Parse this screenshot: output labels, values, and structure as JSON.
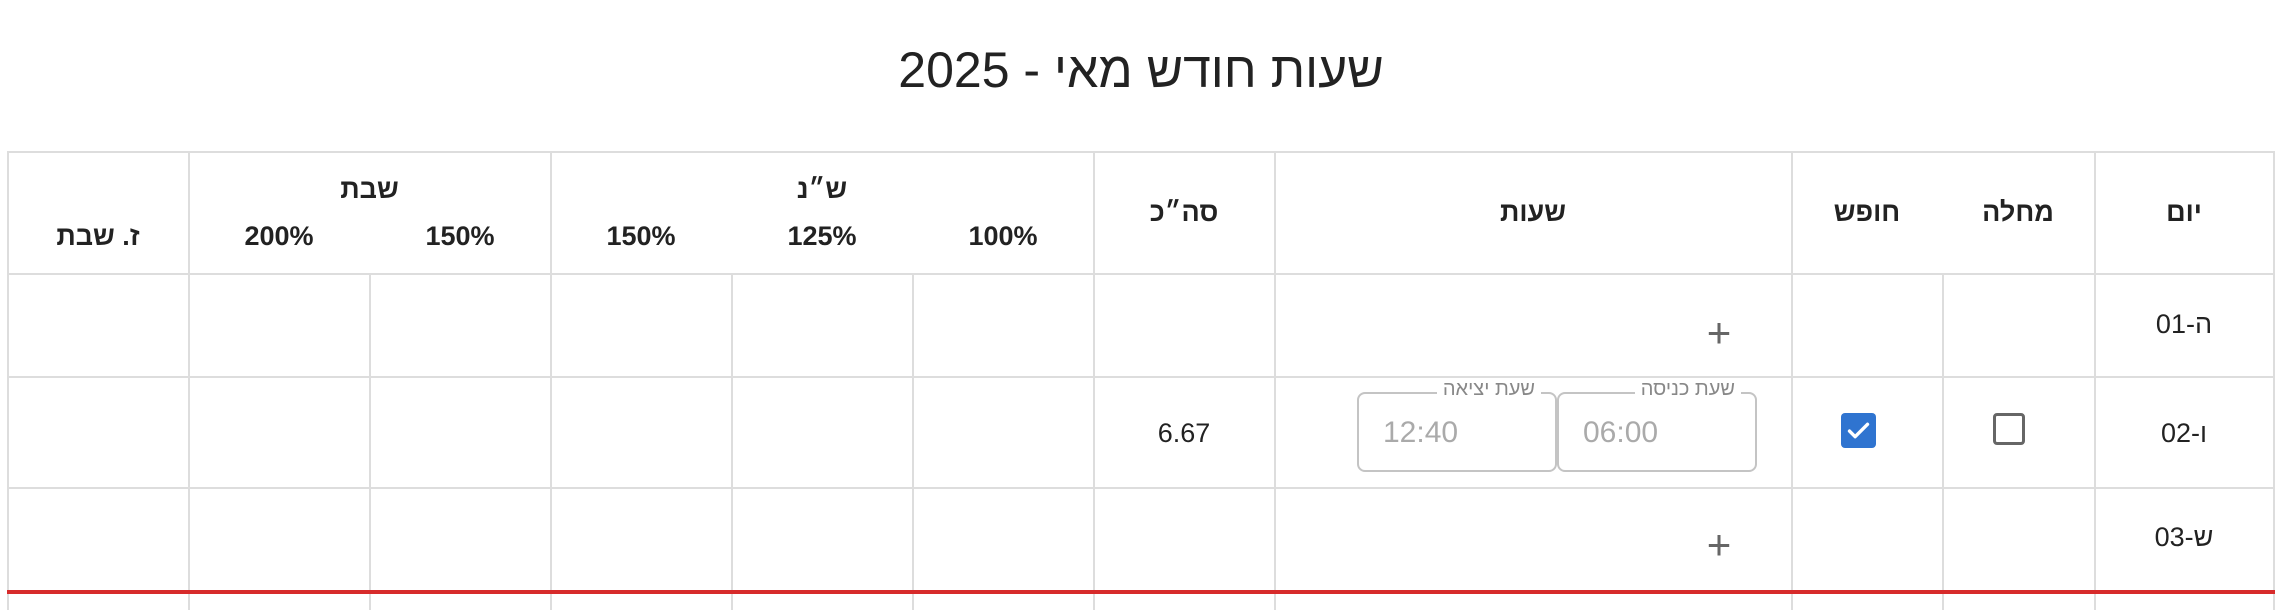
{
  "title": "שעות חודש מאי - 2025",
  "headers": {
    "day": "יום",
    "sick": "מחלה",
    "vacation": "חופש",
    "hours": "שעות",
    "total": "סה״כ",
    "weekday_group": "ש״נ",
    "weekday_100": "100%",
    "weekday_125": "125%",
    "weekday_150": "150%",
    "shabbat_group": "שבת",
    "shabbat_150": "150%",
    "shabbat_200": "200%",
    "shabbat_z": "ז. שבת"
  },
  "rows": [
    {
      "day": "ה-01",
      "add": "+"
    },
    {
      "day": "ו-02",
      "sick_checked": false,
      "vacation_checked": true,
      "entry_label": "שעת כניסה",
      "entry_value": "06:00",
      "exit_label": "שעת יציאה",
      "exit_value": "12:40",
      "total": "6.67"
    },
    {
      "day": "ש-03",
      "add": "+"
    }
  ]
}
